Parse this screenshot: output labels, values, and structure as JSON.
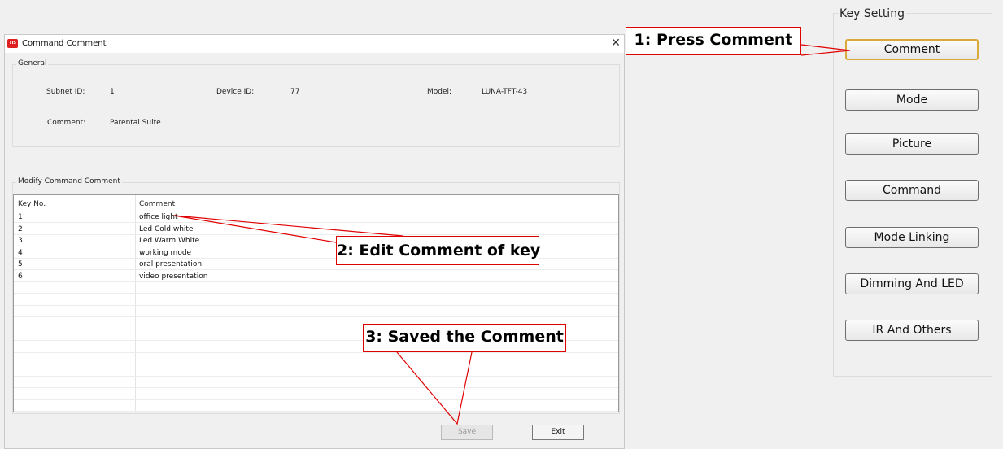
{
  "dialog": {
    "title": "Command Comment",
    "app_icon_text": "TIS",
    "close_glyph": "✕",
    "general": {
      "legend": "General",
      "subnet_id_label": "Subnet ID:",
      "subnet_id_value": "1",
      "device_id_label": "Device ID:",
      "device_id_value": "77",
      "model_label": "Model:",
      "model_value": "LUNA-TFT-43",
      "comment_label": "Comment:",
      "comment_value": "Parental Suite"
    },
    "modify": {
      "legend": "Modify Command Comment",
      "columns": [
        "Key No.",
        "Comment"
      ],
      "rows": [
        {
          "key": "1",
          "comment": "office light"
        },
        {
          "key": "2",
          "comment": "Led Cold white"
        },
        {
          "key": "3",
          "comment": "Led Warm White"
        },
        {
          "key": "4",
          "comment": "working mode"
        },
        {
          "key": "5",
          "comment": "oral presentation"
        },
        {
          "key": "6",
          "comment": "video presentation"
        }
      ]
    },
    "save_label": "Save",
    "exit_label": "Exit"
  },
  "key_setting": {
    "legend": "Key Setting",
    "buttons": [
      "Comment",
      "Mode",
      "Picture",
      "Command",
      "Mode Linking",
      "Dimming And LED",
      "IR And Others"
    ]
  },
  "annotations": {
    "step1": "1: Press Comment",
    "step2": "2: Edit Comment of key",
    "step3": "3: Saved the Comment"
  },
  "colors": {
    "annotation_border": "#e00000",
    "selected_button_border": "#d9a93a"
  }
}
